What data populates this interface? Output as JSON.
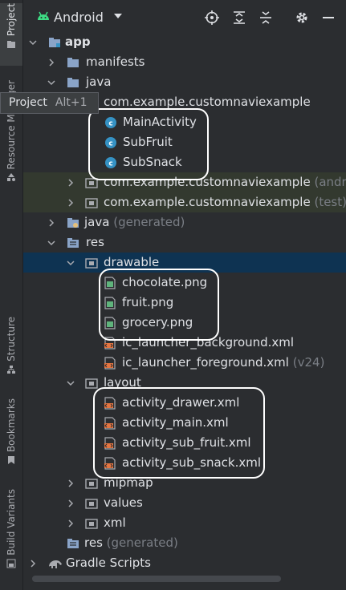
{
  "side_strip": {
    "project": "Project",
    "resource_manager": "Resource Manager",
    "structure": "Structure",
    "bookmarks": "Bookmarks",
    "build_variants": "Build Variants"
  },
  "toolbar": {
    "title": "Android",
    "icons": [
      "target-icon",
      "expand-all-icon",
      "collapse-all-icon",
      "gear-icon",
      "minimize-icon"
    ]
  },
  "tooltip": {
    "label": "Project",
    "shortcut": "Alt+1"
  },
  "tree": {
    "app": "app",
    "manifests": "manifests",
    "java": "java",
    "package_main": "com.example.customnaviexample",
    "main_activity": "MainActivity",
    "sub_fruit": "SubFruit",
    "sub_snack": "SubSnack",
    "package_android_test": "com.example.customnaviexample",
    "package_android_test_sfx": "(andro",
    "package_test": "com.example.customnaviexample",
    "package_test_sfx": "(test)",
    "java_generated": "java",
    "java_generated_sfx": "(generated)",
    "res": "res",
    "drawable": "drawable",
    "chocolate": "chocolate.png",
    "fruit": "fruit.png",
    "grocery": "grocery.png",
    "ic_launcher_background": "ic_launcher_background.xml",
    "ic_launcher_foreground": "ic_launcher_foreground.xml",
    "ic_launcher_foreground_sfx": "(v24)",
    "layout": "layout",
    "activity_drawer": "activity_drawer.xml",
    "activity_main": "activity_main.xml",
    "activity_sub_fruit": "activity_sub_fruit.xml",
    "activity_sub_snack": "activity_sub_snack.xml",
    "mipmap": "mipmap",
    "values": "values",
    "xml": "xml",
    "res_generated": "res",
    "res_generated_sfx": "(generated)",
    "gradle_scripts": "Gradle Scripts"
  },
  "colors": {
    "background": "#2b2d30",
    "selection": "#0e3352",
    "test_highlight": "#33392f",
    "folder": "#8aa4c8",
    "class_icon": "#3592c4",
    "android_green": "#3ddc84",
    "xml_icon": "#e57541"
  }
}
